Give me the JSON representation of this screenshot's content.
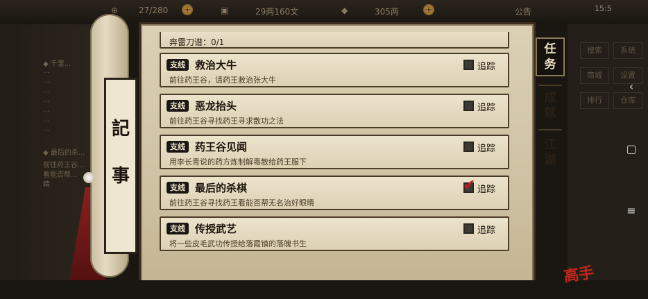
{
  "topbar": {
    "stamina": "27/280",
    "silver": "29两160文",
    "gold": "305两",
    "announcement": "公告",
    "time": "15:5"
  },
  "left_bg": {
    "lines": [
      "◆ 千里...",
      "...",
      "...",
      "...",
      "...",
      "...",
      "...",
      "...",
      "◆ 最后的杀...",
      "前往药王谷...",
      "看能否帮...",
      "睛"
    ]
  },
  "scroll": {
    "char1": "記",
    "char2": "事"
  },
  "quests": [
    {
      "partial": true,
      "progress_text": "奔雷刀谱：0/1"
    },
    {
      "tag": "支线",
      "title": "救治大牛",
      "desc": "前往药王谷，请药王救治张大牛",
      "track_label": "追踪",
      "tracked": false
    },
    {
      "tag": "支线",
      "title": "恶龙抬头",
      "desc": "前往药王谷寻找药王寻求散功之法",
      "track_label": "追踪",
      "tracked": false
    },
    {
      "tag": "支线",
      "title": "药王谷见闻",
      "desc": "用李长青说的药方炼制解毒散给药王服下",
      "track_label": "追踪",
      "tracked": false
    },
    {
      "tag": "支线",
      "title": "最后的杀棋",
      "desc": "前往药王谷寻找药王看能否帮无名治好眼睛",
      "track_label": "追踪",
      "tracked": true
    },
    {
      "tag": "支线",
      "title": "传授武艺",
      "desc": "将一些皮毛武功传授给落霞镇的落魄书生",
      "track_label": "追踪",
      "tracked": false
    }
  ],
  "tabs": [
    {
      "label_top": "任",
      "label_bottom": "务",
      "active": true
    },
    {
      "label_top": "成",
      "label_bottom": "就",
      "active": false
    },
    {
      "label_top": "江",
      "label_bottom": "湖",
      "active": false
    }
  ],
  "right_bg": {
    "buttons": [
      "搜索",
      "系统",
      "商城",
      "设置",
      "排行",
      "仓库"
    ]
  },
  "system_nav": {
    "back": "‹",
    "home": "▢",
    "menu": "≡"
  },
  "seal_text": "高手",
  "colors": {
    "accent_red": "#c41a1a",
    "paper": "#dcd0b5",
    "tag_bg": "#1b1713"
  }
}
